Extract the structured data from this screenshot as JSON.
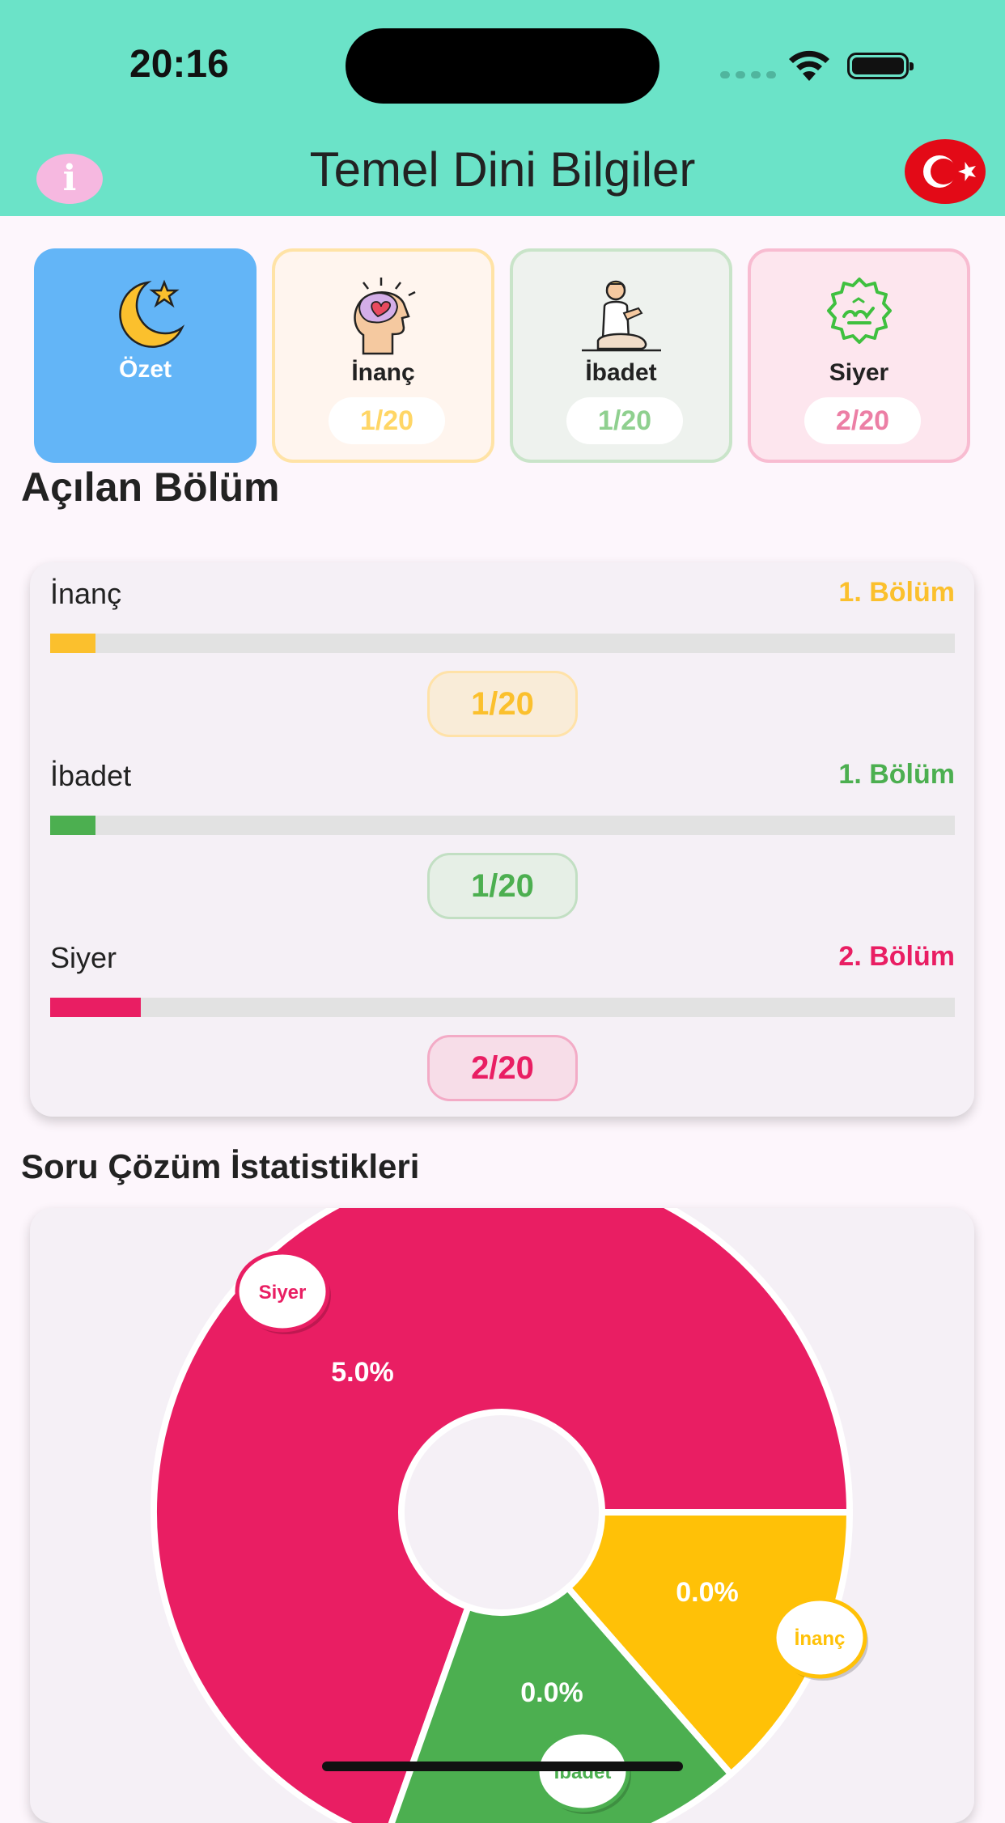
{
  "status_bar": {
    "time": "20:16"
  },
  "header": {
    "title": "Temel Dini Bilgiler",
    "info_icon": "info-icon",
    "flag_icon": "turkey-flag-icon",
    "color": "#6be3c8"
  },
  "categories": [
    {
      "label": "Özet",
      "icon": "crescent-star-icon",
      "color": "#63b5f7"
    },
    {
      "label": "İnanç",
      "icon": "head-heart-icon",
      "progress": "1/20",
      "color": "#ffd666"
    },
    {
      "label": "İbadet",
      "icon": "praying-person-icon",
      "progress": "1/20",
      "color": "#8fd08f"
    },
    {
      "label": "Siyer",
      "icon": "muhammad-calligraphy-icon",
      "progress": "2/20",
      "color": "#ec7fa5"
    }
  ],
  "opened_section": {
    "title": "Açılan Bölüm",
    "rows": [
      {
        "name": "İnanç",
        "section": "1. Bölüm",
        "progress": "1/20",
        "fraction": 0.05,
        "color": "#fbc02d"
      },
      {
        "name": "İbadet",
        "section": "1. Bölüm",
        "progress": "1/20",
        "fraction": 0.05,
        "color": "#4caf50"
      },
      {
        "name": "Siyer",
        "section": "2. Bölüm",
        "progress": "2/20",
        "fraction": 0.1,
        "color": "#e91e63"
      }
    ]
  },
  "stats": {
    "title": "Soru Çözüm İstatistikleri"
  },
  "chart_data": {
    "type": "pie",
    "title": "",
    "categories": [
      "Siyer",
      "İnanç",
      "İbadet"
    ],
    "values": [
      5.0,
      0.0,
      0.0
    ],
    "slice_labels": [
      "5.0%",
      "0.0%",
      "0.0%"
    ],
    "colors": [
      "#e91e63",
      "#ffc107",
      "#4caf50"
    ]
  }
}
